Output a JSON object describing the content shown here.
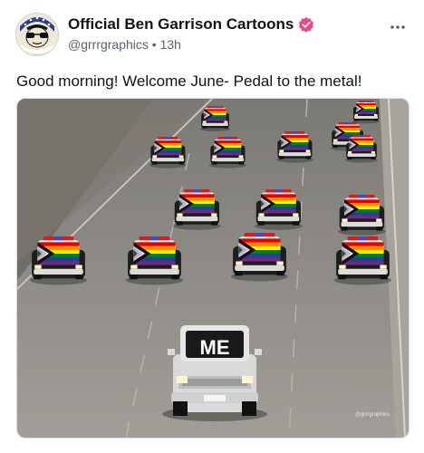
{
  "post": {
    "author_name": "Official  Ben Garrison Cartoons",
    "handle": "@grrrgraphics",
    "separator": "•",
    "time": "13h",
    "text": "Good morning! Welcome June- Pedal to the metal!",
    "verified_badge_icon": "verified-check-icon",
    "more_icon": "more-horizontal-icon"
  },
  "media": {
    "truck_label": "ME",
    "watermark": "@grrrgraphics"
  },
  "colors": {
    "badge": "#e8478b",
    "road": "#8d8a86",
    "truck": "#dedede",
    "police_black": "#1d1d1d"
  }
}
